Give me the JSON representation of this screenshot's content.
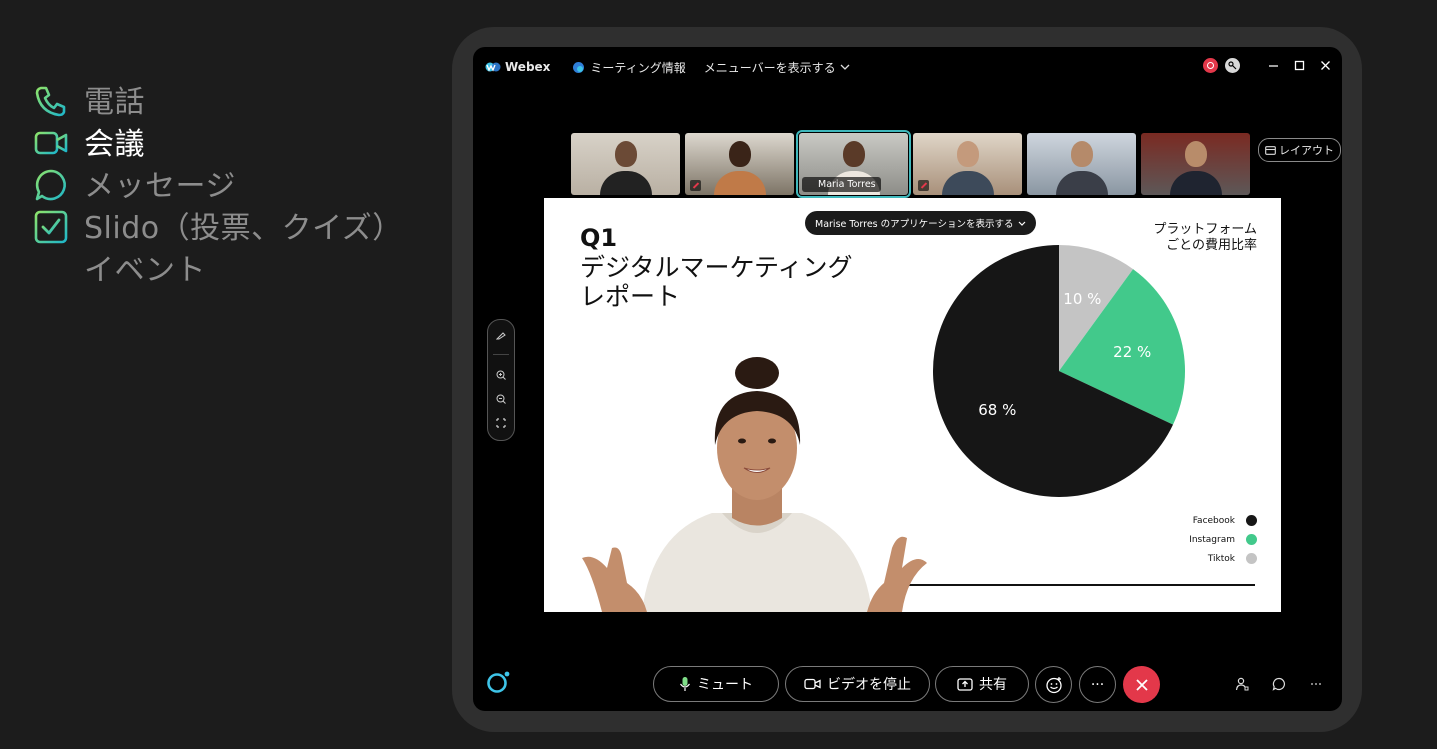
{
  "features": [
    {
      "label": "電話",
      "icon": "phone-icon",
      "active": false
    },
    {
      "label": "会議",
      "icon": "video-icon",
      "active": true
    },
    {
      "label": "メッセージ",
      "icon": "message-icon",
      "active": false
    },
    {
      "label": "Slido（投票、クイズ）",
      "label2": "イベント",
      "icon": "checkbox-icon",
      "active": false
    }
  ],
  "topbar": {
    "app_name": "Webex",
    "meeting_info": "ミーティング情報",
    "menubar": "メニューバーを表示する"
  },
  "thumbnails": {
    "active_name": "Maria Torres",
    "layout_label": "レイアウト"
  },
  "slide": {
    "share_label": "Marise Torres のアプリケーションを表示する",
    "q": "Q1",
    "title_line1": "デジタルマーケティング",
    "title_line2": "レポート",
    "chart_title_line1": "プラットフォーム",
    "chart_title_line2": "ごとの費用比率"
  },
  "chart_data": {
    "type": "pie",
    "title": "プラットフォームごとの費用比率",
    "labels": [
      "Facebook",
      "Instagram",
      "Tiktok"
    ],
    "values": [
      68,
      22,
      10
    ],
    "value_labels": [
      "68 %",
      "22 %",
      "10 %"
    ],
    "colors": [
      "#161616",
      "#42c98b",
      "#c4c4c4"
    ],
    "legend_position": "bottom-right"
  },
  "controls": {
    "mute": "ミュート",
    "stop_video": "ビデオを停止",
    "share": "共有",
    "more": "···"
  }
}
